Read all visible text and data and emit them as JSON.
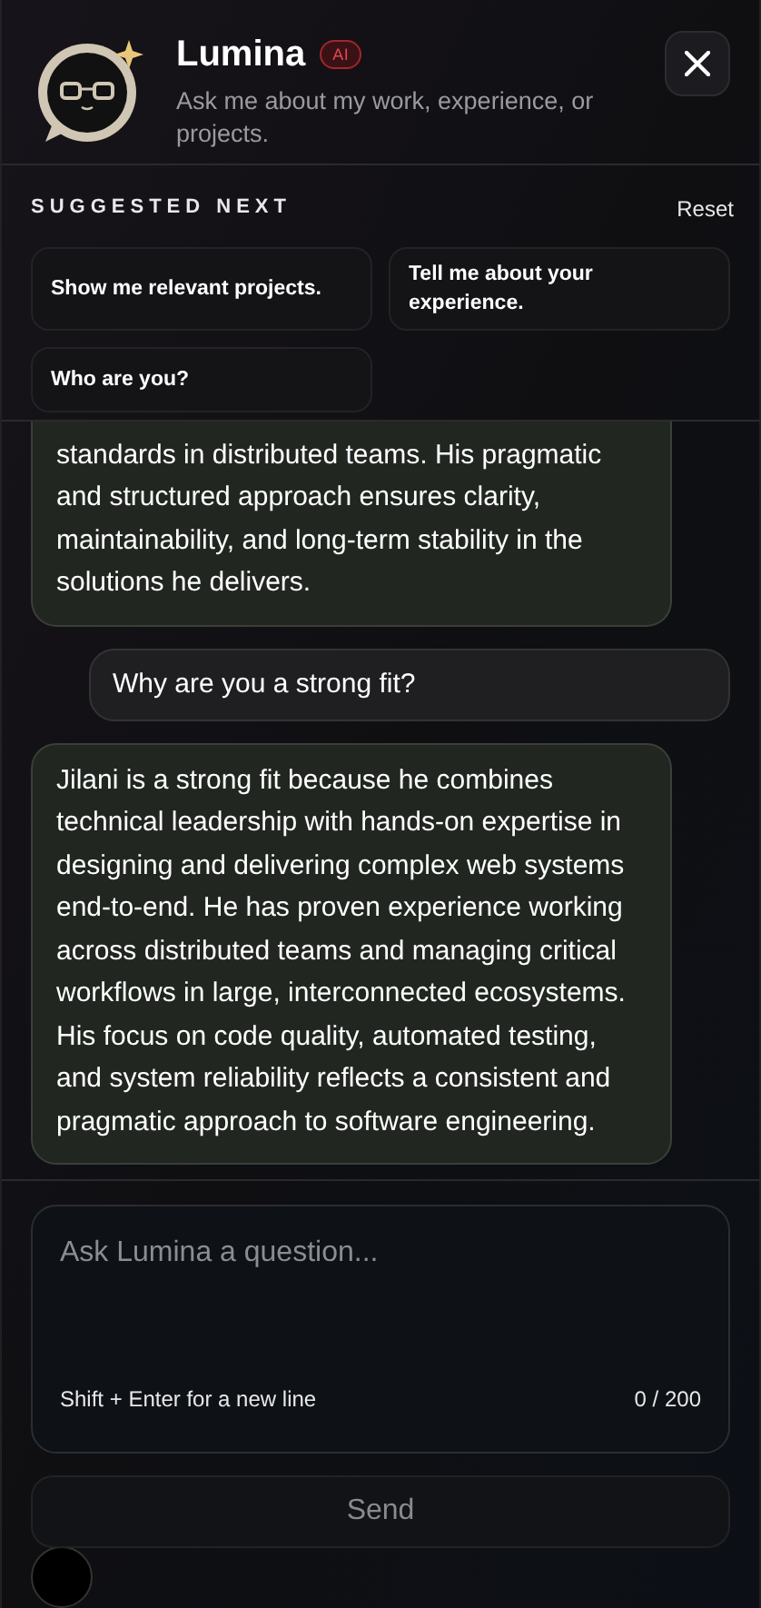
{
  "header": {
    "title": "Lumina",
    "badge": "AI",
    "subtitle": "Ask me about my work, experience, or projects."
  },
  "suggestions": {
    "heading": "SUGGESTED NEXT",
    "reset": "Reset",
    "items": [
      {
        "label": "Show me relevant projects."
      },
      {
        "label": "Tell me about your experience."
      },
      {
        "label": "Who are you?"
      }
    ]
  },
  "messages": [
    {
      "kind": "assistant",
      "cut_top": true,
      "text": "standards in distributed teams. His pragmatic and structured approach ensures clarity, maintainability, and long-term stability in the solutions he delivers."
    },
    {
      "kind": "user",
      "cut_top": false,
      "text": "Why are you a strong fit?"
    },
    {
      "kind": "assistant",
      "cut_top": false,
      "text": "Jilani is a strong fit because he combines technical leadership with hands-on expertise in designing and delivering complex web systems end-to-end. He has proven experience working across distributed teams and managing critical workflows in large, interconnected ecosystems. His focus on code quality, automated testing, and system reliability reflects a consistent and pragmatic approach to software engineering."
    }
  ],
  "composer": {
    "placeholder": "Ask Lumina a question...",
    "hint": "Shift + Enter for a new line",
    "counter": "0 / 200",
    "send": "Send",
    "send_disabled": true
  }
}
